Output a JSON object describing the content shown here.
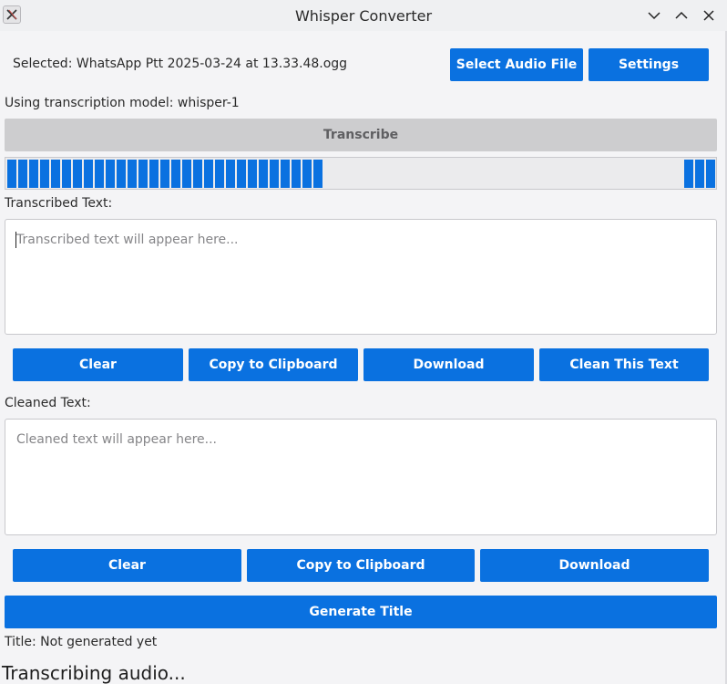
{
  "window": {
    "title": "Whisper Converter"
  },
  "file": {
    "selected_text": "Selected: WhatsApp Ptt 2025-03-24 at 13.33.48.ogg"
  },
  "toolbar": {
    "select_audio_label": "Select Audio File",
    "settings_label": "Settings"
  },
  "model": {
    "text": "Using transcription model: whisper-1"
  },
  "transcribe": {
    "label": "Transcribe",
    "state": "disabled"
  },
  "progress": {
    "indeterminate": true,
    "color": "#0a71e0"
  },
  "transcribed": {
    "label": "Transcribed Text:",
    "placeholder": "Transcribed text will appear here...",
    "buttons": {
      "clear": "Clear",
      "copy": "Copy to Clipboard",
      "download": "Download",
      "clean": "Clean This Text"
    }
  },
  "cleaned": {
    "label": "Cleaned Text:",
    "placeholder": "Cleaned text will appear here...",
    "buttons": {
      "clear": "Clear",
      "copy": "Copy to Clipboard",
      "download": "Download"
    }
  },
  "generate_title": {
    "label": "Generate Title"
  },
  "title_status": {
    "text": "Title: Not generated yet"
  },
  "status": {
    "text": "Transcribing audio..."
  },
  "colors": {
    "accent": "#0a71e0",
    "disabled": "#cdcdcf"
  }
}
